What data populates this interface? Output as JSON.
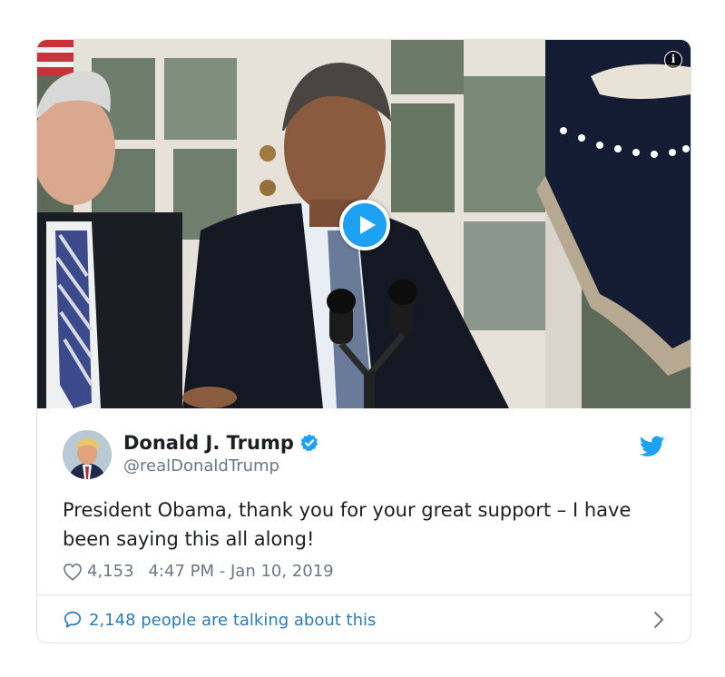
{
  "media": {
    "type": "video",
    "play_icon": "play-icon",
    "info_icon": "info-icon",
    "info_glyph": "i"
  },
  "author": {
    "display_name": "Donald J. Trump",
    "handle": "@realDonaldTrump",
    "verified": true
  },
  "tweet": {
    "text": "President Obama, thank you for your great support – I have been saying this all along!",
    "like_count": "4,153",
    "timestamp": "4:47 PM - Jan 10, 2019"
  },
  "footer": {
    "talking_text": "2,148 people are talking about this"
  },
  "colors": {
    "accent": "#1da1f2",
    "link": "#2b7bb9",
    "text": "#1c2022",
    "muted": "#697882",
    "border": "#dfe3e7"
  }
}
